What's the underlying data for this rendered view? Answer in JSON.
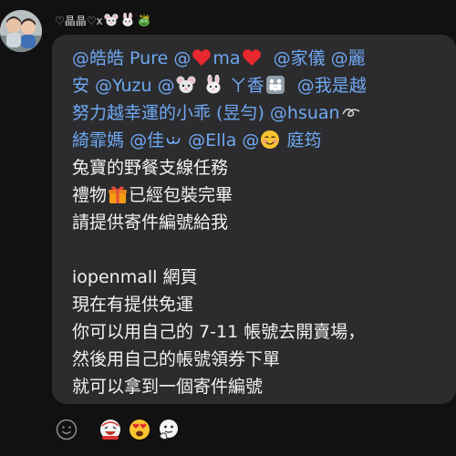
{
  "sender": {
    "name_prefix": "♡晶晶♡x",
    "avatar_icon": "kids-photo-avatar",
    "name_icons": [
      "mouse-face-icon",
      "rabbit-face-icon",
      "dragon-face-icon"
    ]
  },
  "message": {
    "mentions": {
      "m1": "@皓皓 Pure",
      "m2": "@",
      "m2b": "ma",
      "m3": "@家儀",
      "m4": "@麗",
      "m4b": "安",
      "m5": "@Yuzu",
      "m6": "@",
      "m6b": "ㄚ香",
      "m7": "@我是越",
      "m7b": "努力越幸運的小乖 (昱勻)",
      "m8": "@hsuan",
      "m8b": "綺霏媽",
      "m9": "@佳",
      "m10": "@Ella",
      "m11": "@",
      "m11b": "庭筠"
    },
    "lines": [
      "兔寶的野餐支線任務",
      "禮物",
      "已經包裝完畢",
      "請提供寄件編號給我",
      "iopenmall 網頁",
      "現在有提供免運",
      "你可以用自己的 7-11 帳號去開賣場，",
      "然後用自己的帳號領券下單",
      "就可以拿到一個寄件編號"
    ],
    "inline_icons": {
      "heart": "red-heart-icon",
      "mouse": "mouse-face-icon",
      "rabbit": "rabbit-face-icon",
      "family": "family-icon",
      "loop": "curly-loop-icon",
      "bow": "bow-symbol-icon",
      "smile": "smiling-face-icon",
      "gift": "wrapped-gift-icon"
    }
  },
  "reactions": {
    "add_reaction_icon": "add-emoji-icon",
    "stickers": [
      "laughing-sticker-icon",
      "heart-eyes-icon",
      "face-with-hand-icon"
    ]
  },
  "colors": {
    "background": "#111112",
    "bubble": "#2c2c2e",
    "text": "#f2f2f2",
    "mention": "#6fa8f2"
  }
}
